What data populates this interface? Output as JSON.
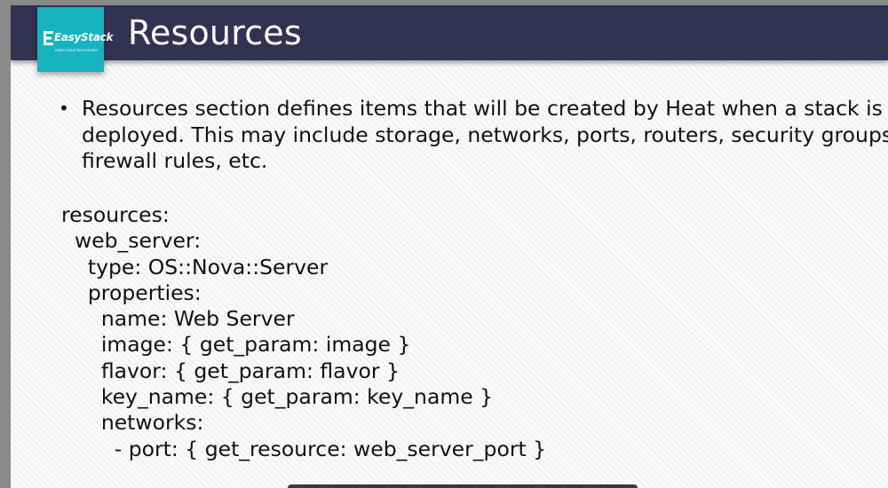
{
  "slide": {
    "title": "Resources",
    "logo": {
      "brand": "EasyStack",
      "tagline": "make cloud foreseeable"
    },
    "bullet": {
      "text": "Resources section defines items that will be created by Heat when a stack is\ndeployed. This may include storage, networks, ports, routers, security groups\nfirewall rules, etc."
    },
    "code": {
      "lines": [
        "resources:",
        "  web_server:",
        "    type: OS::Nova::Server",
        "    properties:",
        "      name: Web Server",
        "      image: { get_param: image }",
        "      flavor: { get_param: flavor }",
        "      key_name: { get_param: key_name }",
        "      networks:",
        "        - port: { get_resource: web_server_port }"
      ]
    }
  },
  "colors": {
    "title_bar": "#343252",
    "logo_bg": "#17b3bf",
    "text": "#111111"
  }
}
